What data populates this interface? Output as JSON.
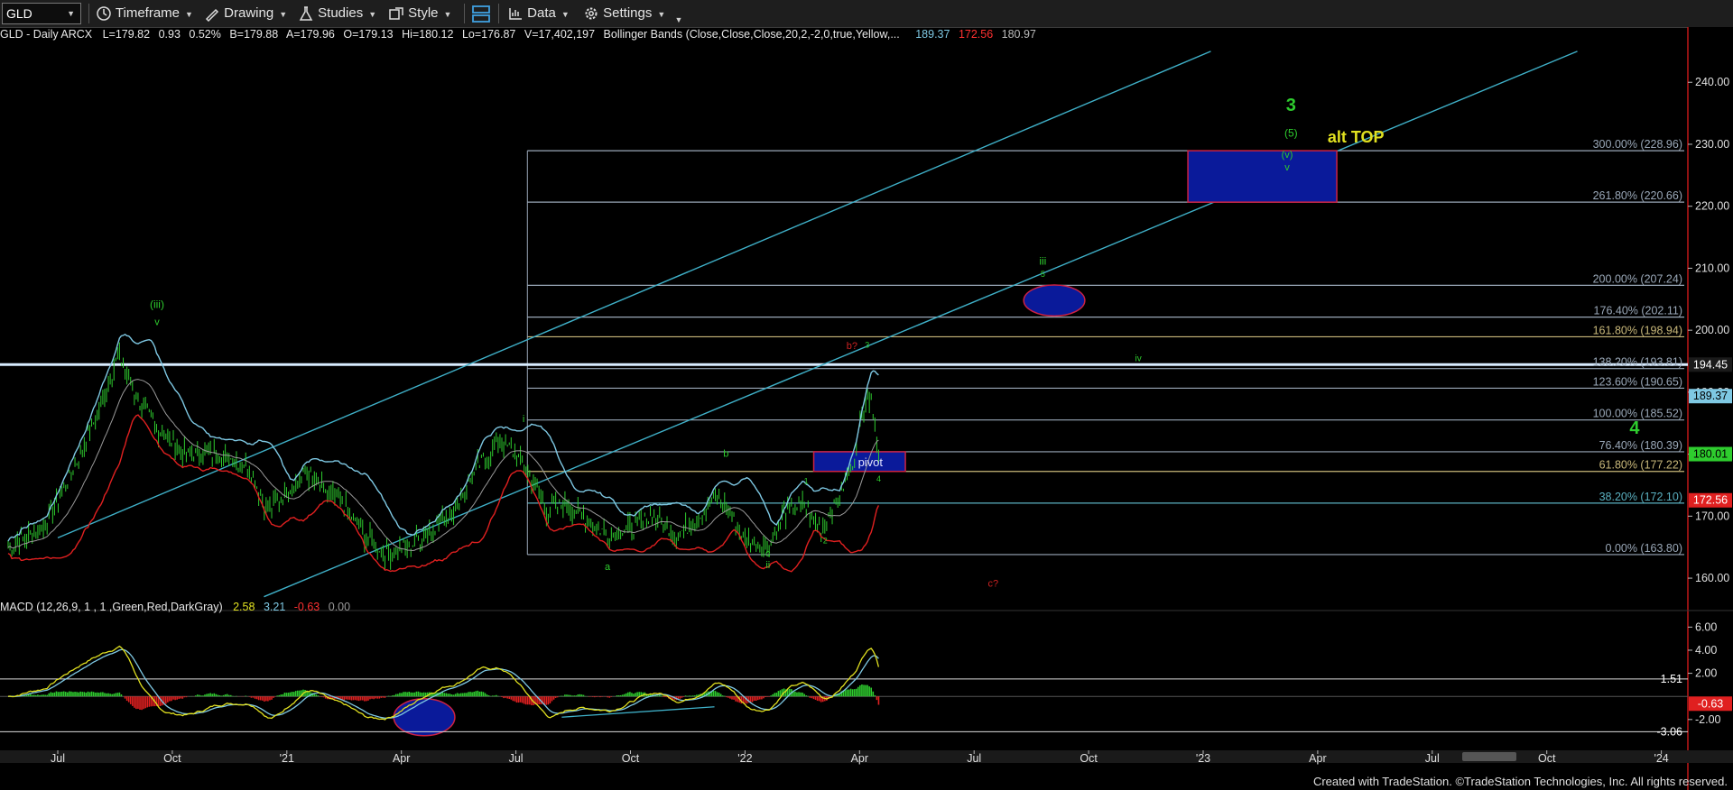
{
  "toolbar": {
    "symbol": "GLD",
    "timeframe": "Timeframe",
    "drawing": "Drawing",
    "studies": "Studies",
    "style": "Style",
    "data": "Data",
    "settings": "Settings"
  },
  "status": {
    "name": "GLD - Daily ARCX",
    "last": "L=179.82",
    "change": "0.93",
    "change_pct": "0.52%",
    "bid": "B=179.88",
    "ask": "A=179.96",
    "open": "O=179.13",
    "high": "Hi=180.12",
    "low": "Lo=176.87",
    "volume": "V=17,402,197",
    "bb_label": "Bollinger Bands (Close,Close,Close,20,2,-2,0,true,Yellow,...",
    "bb_upper": "189.37",
    "bb_lower": "172.56",
    "bb_mid": "180.97"
  },
  "macd": {
    "label": "MACD (12,26,9, 1 , 1 ,Green,Red,DarkGray)",
    "v1": "2.58",
    "v2": "3.21",
    "v3": "-0.63",
    "v4": "0.00"
  },
  "colors": {
    "price": "#2ecc2e",
    "bb_upper": "#7ec8e3",
    "bb_lower": "#e02020",
    "bb_mid": "#9a9a9a",
    "channel": "#3fb0c8",
    "fib": "#9aa8b8",
    "box_fill": "#0a1a9a",
    "box_stroke": "#cc2244",
    "green_label": "#2ecc2e",
    "red_label": "#cc2222",
    "yellow_label": "#e0e020"
  },
  "chart_data": {
    "type": "line",
    "title": "",
    "price_axis": {
      "ticks": [
        "240.00",
        "230.00",
        "220.00",
        "210.00",
        "200.00",
        "190.00",
        "180.00",
        "170.00",
        "160.00"
      ],
      "ylim": [
        155.5,
        246
      ]
    },
    "macd_axis": {
      "ticks": [
        "6.00",
        "4.00",
        "2.00",
        "-2.00"
      ],
      "ylim": [
        -4.2,
        7.2
      ]
    },
    "x_axis": {
      "ticks": [
        "Jul",
        "Oct",
        "'21",
        "Apr",
        "Jul",
        "Oct",
        "'22",
        "Apr",
        "Jul",
        "Oct",
        "'23",
        "Apr",
        "Jul",
        "Oct",
        "'24"
      ],
      "tick_months": [
        0,
        3,
        6,
        9,
        12,
        15,
        18,
        21,
        24,
        27,
        30,
        33,
        36,
        39,
        42
      ],
      "origin": "2020-07"
    },
    "price_tags": [
      {
        "text": "194.45",
        "value": 194.45,
        "bg": "#1a1a1a",
        "fg": "#ffffff"
      },
      {
        "text": "189.37",
        "value": 189.37,
        "bg": "#7ec8e3",
        "fg": "#000000"
      },
      {
        "text": "180.01",
        "value": 180.01,
        "bg": "#2ecc2e",
        "fg": "#000000"
      },
      {
        "text": "172.56",
        "value": 172.56,
        "bg": "#e02020",
        "fg": "#ffffff"
      }
    ],
    "macd_tags": [
      {
        "text": "1.51",
        "value": 1.51,
        "bg": "#000000",
        "fg": "#ffffff"
      },
      {
        "text": "-0.63",
        "value": -0.63,
        "bg": "#e02020",
        "fg": "#ffffff"
      },
      {
        "text": "-3.06",
        "value": -3.06,
        "bg": "#000000",
        "fg": "#ffffff"
      }
    ],
    "fib_levels": [
      {
        "label": "300.00% (228.96)",
        "value": 228.96,
        "color": "#9aa8b8"
      },
      {
        "label": "261.80% (220.66)",
        "value": 220.66,
        "color": "#9aa8b8"
      },
      {
        "label": "200.00% (207.24)",
        "value": 207.24,
        "color": "#9aa8b8"
      },
      {
        "label": "176.40% (202.11)",
        "value": 202.11,
        "color": "#9aa8b8"
      },
      {
        "label": "161.80% (198.94)",
        "value": 198.94,
        "color": "#c9b87a"
      },
      {
        "label": "138.20% (193.81)",
        "value": 193.81,
        "color": "#9aa8b8"
      },
      {
        "label": "123.60% (190.65)",
        "value": 190.65,
        "color": "#9aa8b8"
      },
      {
        "label": "100.00% (185.52)",
        "value": 185.52,
        "color": "#9aa8b8"
      },
      {
        "label": "76.40% (180.39)",
        "value": 180.39,
        "color": "#9aa8b8"
      },
      {
        "label": "61.80% (177.22)",
        "value": 177.22,
        "color": "#c9b87a"
      },
      {
        "label": "38.20% (172.10)",
        "value": 172.1,
        "color": "#5ab0c0"
      },
      {
        "label": "0.00% (163.80)",
        "value": 163.8,
        "color": "#9aa8b8"
      }
    ],
    "horizontal_line": {
      "value": 194.45,
      "color": "#aad4ff"
    },
    "boxes": [
      {
        "label": "",
        "x0": 29.6,
        "x1": 33.5,
        "y0": 220.66,
        "y1": 228.96
      },
      {
        "label": "pivot",
        "x0": 19.8,
        "x1": 22.2,
        "y0": 177.22,
        "y1": 180.39
      }
    ],
    "ellipses": [
      {
        "x": 26.1,
        "y": 204.8,
        "rx": 1.0,
        "ry": 2.5,
        "pane": "price"
      },
      {
        "x": 9.6,
        "y": -1.8,
        "rx": 1.0,
        "ry": 1.6,
        "pane": "macd"
      }
    ],
    "annotations": [
      {
        "text": "(iii)",
        "x": 2.6,
        "y": 203.6,
        "color": "#2ecc2e",
        "size": 12
      },
      {
        "text": "v",
        "x": 2.6,
        "y": 200.8,
        "color": "#2ecc2e",
        "size": 11
      },
      {
        "text": "i",
        "x": 12.2,
        "y": 185.2,
        "color": "#2ecc2e",
        "size": 11
      },
      {
        "text": "b",
        "x": 17.5,
        "y": 179.6,
        "color": "#2ecc2e",
        "size": 11
      },
      {
        "text": "a",
        "x": 14.4,
        "y": 161.3,
        "color": "#2ecc2e",
        "size": 11
      },
      {
        "text": "c",
        "x": 18.6,
        "y": 163.5,
        "color": "#2ecc2e",
        "size": 11
      },
      {
        "text": "ii",
        "x": 18.6,
        "y": 161.6,
        "color": "#2ecc2e",
        "size": 11
      },
      {
        "text": "1",
        "x": 19.6,
        "y": 175.2,
        "color": "#2ecc2e",
        "size": 9
      },
      {
        "text": "2",
        "x": 20.1,
        "y": 165.6,
        "color": "#2ecc2e",
        "size": 9
      },
      {
        "text": "3",
        "x": 21.2,
        "y": 197.2,
        "color": "#2ecc2e",
        "size": 9
      },
      {
        "text": "4",
        "x": 21.5,
        "y": 175.6,
        "color": "#2ecc2e",
        "size": 9
      },
      {
        "text": "b?",
        "x": 20.8,
        "y": 197.0,
        "color": "#cc2222",
        "size": 11
      },
      {
        "text": "c?",
        "x": 24.5,
        "y": 158.6,
        "color": "#cc2222",
        "size": 11
      },
      {
        "text": "iii",
        "x": 25.8,
        "y": 210.6,
        "color": "#2ecc2e",
        "size": 12
      },
      {
        "text": "5",
        "x": 25.8,
        "y": 208.6,
        "color": "#2ecc2e",
        "size": 9
      },
      {
        "text": "iv",
        "x": 28.3,
        "y": 195.0,
        "color": "#2ecc2e",
        "size": 10
      },
      {
        "text": "3",
        "x": 32.3,
        "y": 235.4,
        "color": "#2ecc2e",
        "size": 20
      },
      {
        "text": "(5)",
        "x": 32.3,
        "y": 231.2,
        "color": "#2ecc2e",
        "size": 12
      },
      {
        "text": "(v)",
        "x": 32.2,
        "y": 227.8,
        "color": "#2ecc2e",
        "size": 11
      },
      {
        "text": "v",
        "x": 32.2,
        "y": 225.8,
        "color": "#2ecc2e",
        "size": 11
      },
      {
        "text": "alt TOP",
        "x": 34.0,
        "y": 230.3,
        "color": "#e0e020",
        "size": 18
      },
      {
        "text": "4",
        "x": 41.3,
        "y": 183.3,
        "color": "#2ecc2e",
        "size": 20
      }
    ],
    "channel_lines": [
      {
        "x0": 0,
        "y0": 166.5,
        "x1": 30.2,
        "y1": 245.0
      },
      {
        "x0": 5.4,
        "y0": 157.0,
        "x1": 39.8,
        "y1": 245.0
      }
    ],
    "macd_trendline": {
      "x0": 13.2,
      "y0": -1.8,
      "x1": 17.2,
      "y1": -0.9
    }
  },
  "credit": "Created with TradeStation. ©TradeStation Technologies, Inc. All rights reserved."
}
